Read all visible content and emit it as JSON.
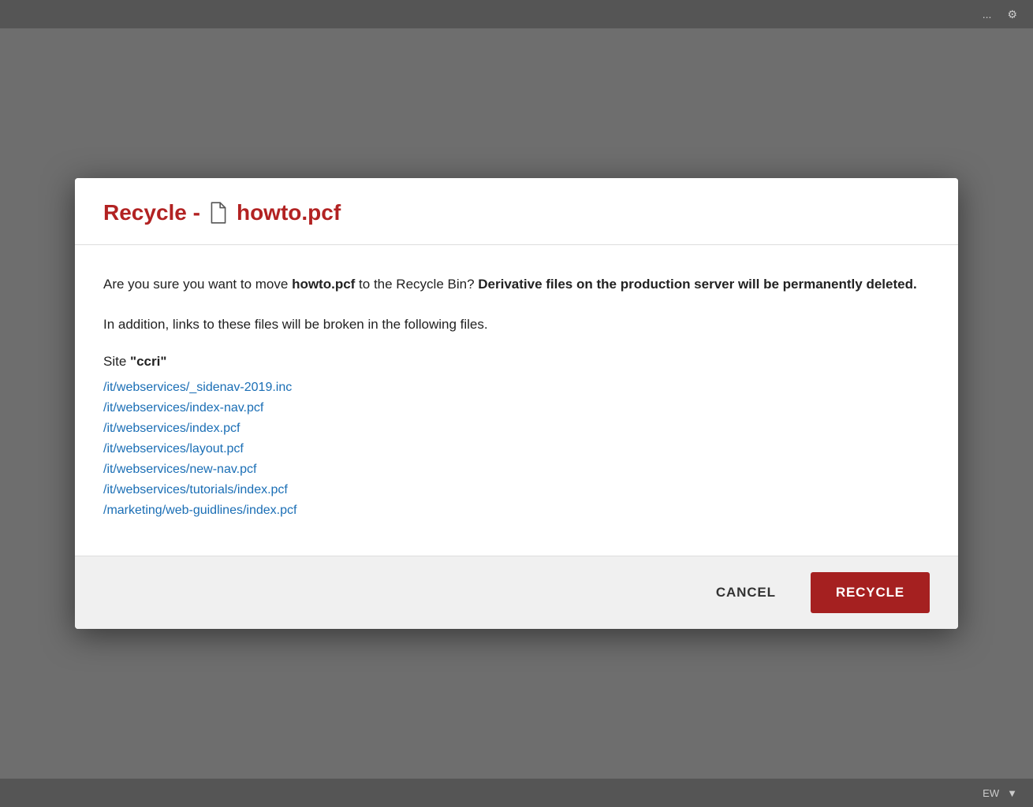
{
  "background": {
    "color": "#888888"
  },
  "topbar": {
    "items": [
      "...",
      "⚙"
    ]
  },
  "modal": {
    "header": {
      "title_prefix": "Recycle -",
      "filename": "howto.pcf"
    },
    "body": {
      "confirm_text_part1": "Are you sure you want to move ",
      "confirm_filename": "howto.pcf",
      "confirm_text_part2": " to the Recycle Bin? ",
      "confirm_warning": "Derivative files on the production server will be permanently deleted.",
      "broken_links_text": "In addition, links to these files will be broken in the following files.",
      "site_label_prefix": "Site ",
      "site_name": "\"ccri\"",
      "file_links": [
        "/it/webservices/_sidenav-2019.inc",
        "/it/webservices/index-nav.pcf",
        "/it/webservices/index.pcf",
        "/it/webservices/layout.pcf",
        "/it/webservices/new-nav.pcf",
        "/it/webservices/tutorials/index.pcf",
        "/marketing/web-guidlines/index.pcf"
      ]
    },
    "footer": {
      "cancel_label": "CANCEL",
      "recycle_label": "RECYCLE"
    }
  },
  "bottombar": {
    "ew_label": "EW",
    "chevron": "▼"
  }
}
